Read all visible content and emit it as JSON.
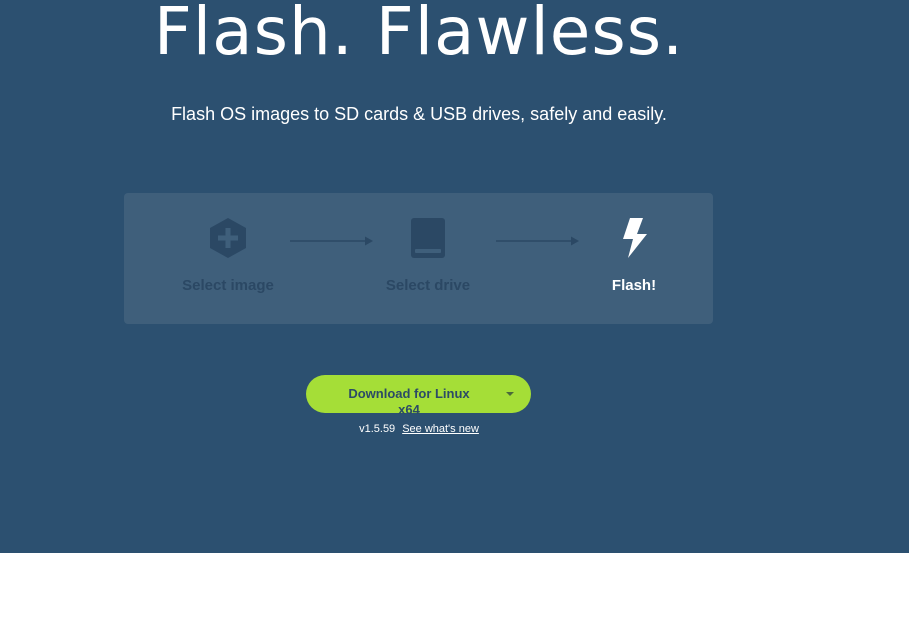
{
  "hero": {
    "headline": "Flash. Flawless.",
    "tagline": "Flash OS images to SD cards & USB drives, safely and easily."
  },
  "steps": [
    {
      "label": "Select image",
      "icon": "plus-hexagon-icon",
      "state": "disabled"
    },
    {
      "label": "Select drive",
      "icon": "drive-icon",
      "state": "disabled"
    },
    {
      "label": "Flash!",
      "icon": "lightning-bolt-icon",
      "state": "active"
    }
  ],
  "download": {
    "label": "Download for Linux x64",
    "dropdown_icon": "caret-down-icon",
    "version": "v1.5.59",
    "whats_new": "See what's new"
  },
  "colors": {
    "hero_background": "#2c5070",
    "panel_background": "#3f5f7b",
    "disabled_step": "#2b4864",
    "download_button": "#a5de37",
    "text": "#ffffff"
  }
}
